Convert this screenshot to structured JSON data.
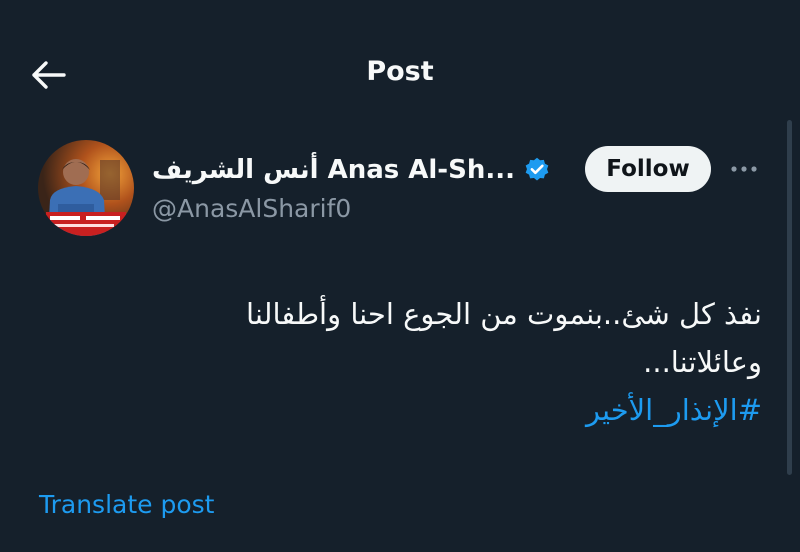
{
  "header": {
    "title": "Post"
  },
  "author": {
    "display_name": "أنس الشريف Anas Al-Sh...",
    "handle": "@AnasAlSharif0",
    "verified": true,
    "follow_label": "Follow"
  },
  "post": {
    "text_line1": "نفذ كل شئ..بنموت من الجوع احنا وأطفالنا",
    "text_line2": "وعائلاتنا...",
    "hashtag": "#الإنذار_الأخير"
  },
  "translate_label": "Translate post",
  "colors": {
    "background": "#15202b",
    "accent": "#1d9bf0",
    "text": "#f7f9f9",
    "muted": "#8b98a5"
  }
}
